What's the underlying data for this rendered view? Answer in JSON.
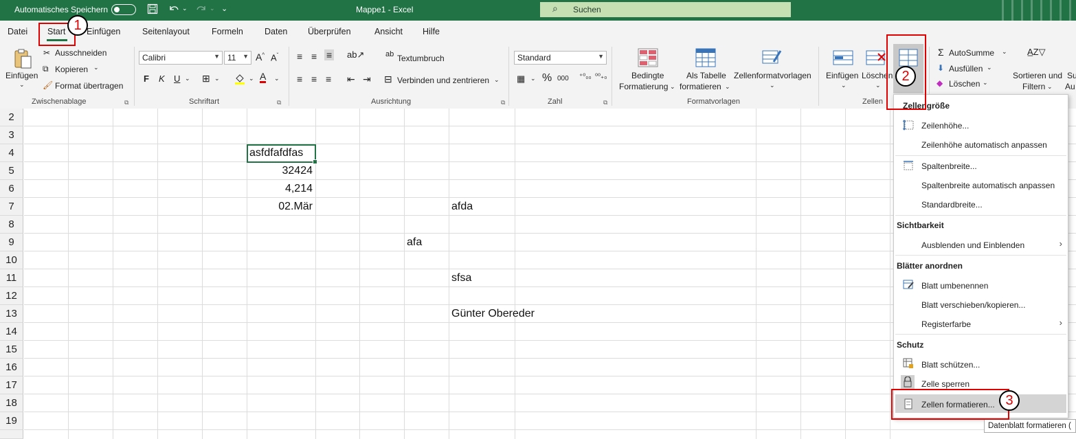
{
  "titlebar": {
    "autosave_label": "Automatisches Speichern",
    "doc_title": "Mappe1  -  Excel",
    "search_placeholder": "Suchen"
  },
  "tabs": [
    "Datei",
    "Start",
    "Einfügen",
    "Seitenlayout",
    "Formeln",
    "Daten",
    "Überprüfen",
    "Ansicht",
    "Hilfe"
  ],
  "ribbon": {
    "clipboard": {
      "paste": "Einfügen",
      "cut": "Ausschneiden",
      "copy": "Kopieren",
      "format_painter": "Format übertragen",
      "label": "Zwischenablage"
    },
    "font": {
      "name": "Calibri",
      "size": "11",
      "bold": "F",
      "italic": "K",
      "underline": "U",
      "label": "Schriftart"
    },
    "alignment": {
      "wrap": "Textumbruch",
      "merge": "Verbinden und zentrieren",
      "label": "Ausrichtung"
    },
    "number": {
      "format": "Standard",
      "percent": "%",
      "thousands": "000",
      "label": "Zahl"
    },
    "styles": {
      "conditional_1": "Bedingte",
      "conditional_2": "Formatierung",
      "table_1": "Als Tabelle",
      "table_2": "formatieren",
      "cellstyles": "Zellenformatvorlagen",
      "label": "Formatvorlagen"
    },
    "cells": {
      "insert": "Einfügen",
      "delete": "Löschen",
      "format": "Format",
      "label": "Zellen"
    },
    "editing": {
      "autosum": "AutoSumme",
      "fill": "Ausfüllen",
      "clear": "Löschen",
      "sort_1": "Sortieren und",
      "sort_2": "Filtern",
      "find_1": "Su",
      "find_2": "Au"
    }
  },
  "rows": [
    "2",
    "3",
    "4",
    "5",
    "6",
    "7",
    "8",
    "9",
    "10",
    "11",
    "12",
    "13",
    "14",
    "15",
    "16",
    "17",
    "18",
    "19"
  ],
  "cells": {
    "d4": "asfdfafdfas",
    "d5": "32424",
    "d6": "4,214",
    "d7": "02.Mär",
    "i7": "afda",
    "h9": "afa",
    "i11": "sfsa",
    "i13": "Günter Obereder"
  },
  "menu": {
    "section_size": "Zellengröße",
    "row_height": "Zeilenhöhe...",
    "row_autofit": "Zeilenhöhe automatisch anpassen",
    "col_width": "Spaltenbreite...",
    "col_autofit": "Spaltenbreite automatisch anpassen",
    "default_width": "Standardbreite...",
    "section_visibility": "Sichtbarkeit",
    "hide_show": "Ausblenden und Einblenden",
    "section_sheets": "Blätter anordnen",
    "rename": "Blatt umbenennen",
    "move_copy": "Blatt verschieben/kopieren...",
    "tab_color": "Registerfarbe",
    "section_protect": "Schutz",
    "protect_sheet": "Blatt schützen...",
    "lock_cell": "Zelle sperren",
    "format_cells": "Zellen formatieren..."
  },
  "tooltip": "Datenblatt formatieren (",
  "callouts": [
    "1",
    "2",
    "3"
  ],
  "colors": {
    "excel_green": "#217346",
    "callout_red": "#e00000"
  }
}
